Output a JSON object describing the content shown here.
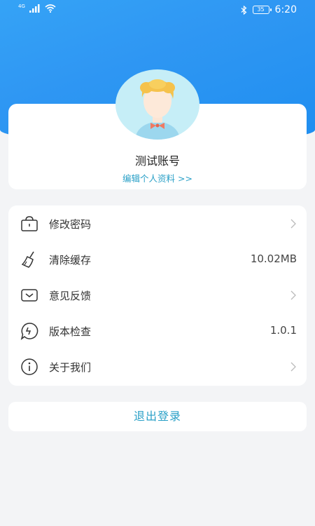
{
  "status_bar": {
    "network_label": "4G",
    "battery": "35",
    "time": "6:20"
  },
  "profile": {
    "name": "测试账号",
    "edit_link": "编辑个人资料 >>"
  },
  "menu": {
    "items": [
      {
        "label": "修改密码",
        "icon": "lock-icon",
        "value": "",
        "chevron": true
      },
      {
        "label": "清除缓存",
        "icon": "broom-icon",
        "value": "10.02MB",
        "chevron": false
      },
      {
        "label": "意见反馈",
        "icon": "envelope-icon",
        "value": "",
        "chevron": true
      },
      {
        "label": "版本检查",
        "icon": "update-bubble-icon",
        "value": "1.0.1",
        "chevron": false
      },
      {
        "label": "关于我们",
        "icon": "info-icon",
        "value": "",
        "chevron": true
      }
    ]
  },
  "logout_label": "退出登录",
  "colors": {
    "header_blue": "#2f97f3",
    "accent_teal": "#2aa0c7",
    "background": "#f3f4f6"
  }
}
